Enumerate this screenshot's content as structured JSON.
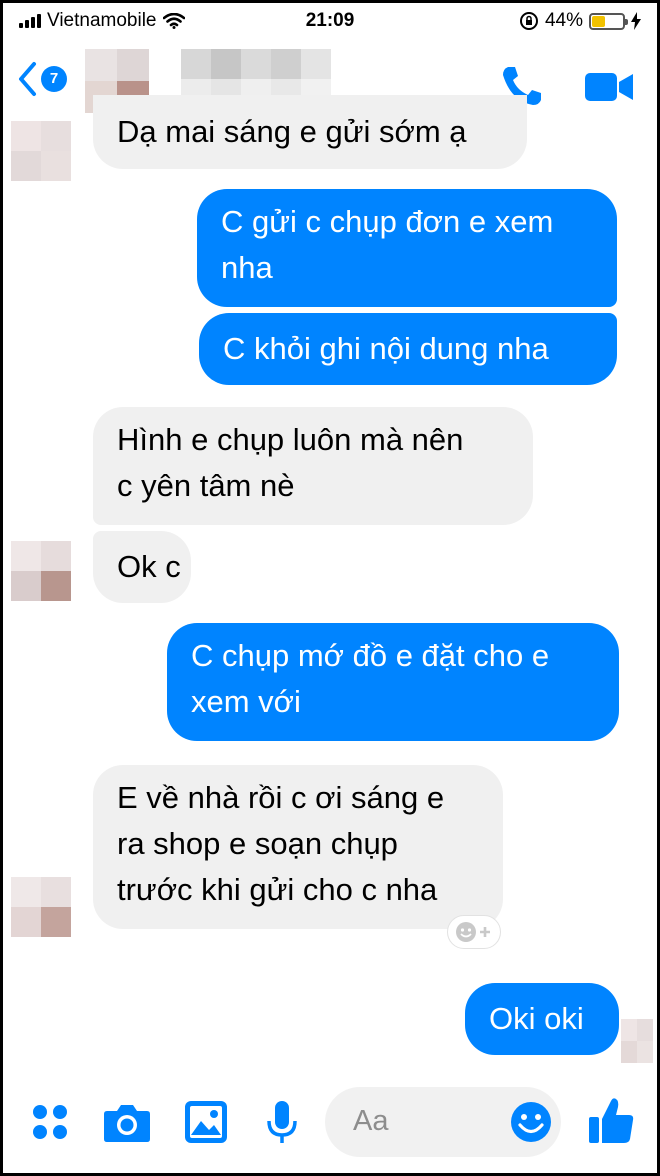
{
  "status_bar": {
    "carrier": "Vietnamobile",
    "time": "21:09",
    "battery_percent": "44%",
    "battery_level": 0.44
  },
  "header": {
    "unread_count": "7",
    "accent_color": "#0084ff"
  },
  "messages": [
    {
      "direction": "in",
      "lines": [
        "Dạ mai sáng e gửi sớm ạ"
      ]
    },
    {
      "direction": "out",
      "lines": [
        "C gửi c chụp đơn e xem",
        "nha"
      ]
    },
    {
      "direction": "out",
      "lines": [
        "C khỏi ghi nội dung nha"
      ]
    },
    {
      "direction": "in",
      "lines": [
        "Hình e chụp luôn mà nên",
        "c yên tâm nè"
      ]
    },
    {
      "direction": "in",
      "lines": [
        "Ok c"
      ]
    },
    {
      "direction": "out",
      "lines": [
        "C chụp mớ đồ e đặt cho e",
        "xem với"
      ]
    },
    {
      "direction": "in",
      "lines": [
        "E về nhà rồi c ơi sáng e",
        "ra shop e soạn chụp",
        "trước khi gửi cho c nha"
      ]
    },
    {
      "direction": "out",
      "lines": [
        "Oki oki"
      ]
    }
  ],
  "composer": {
    "placeholder": "Aa"
  },
  "icons": [
    "back-chevron-icon",
    "phone-icon",
    "video-camera-icon",
    "apps-grid-icon",
    "camera-icon",
    "image-gallery-icon",
    "microphone-icon",
    "emoji-icon",
    "thumbs-up-icon",
    "add-reaction-icon"
  ]
}
